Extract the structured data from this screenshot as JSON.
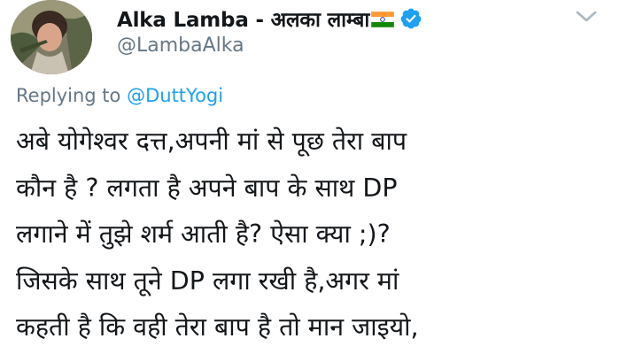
{
  "tweet": {
    "author": {
      "display_name": "Alka Lamba - अलका लाम्बा",
      "handle": "@LambaAlka",
      "verified": true,
      "flag_icon": "india-flag-icon",
      "verified_icon": "verified-badge-icon"
    },
    "menu_icon": "chevron-down-icon",
    "replying_prefix": "Replying to",
    "replying_to": "@DuttYogi",
    "body_lines": [
      "अबे योगेश्वर दत्त,अपनी मां से पूछ तेरा बाप",
      "कौन है ? लगता है अपने बाप के साथ DP",
      "लगाने में तुझे शर्म आती है? ऐसा क्या ;)?",
      "जिसके साथ तूने DP लगा रखी है,अगर मां",
      "कहती है कि वही तेरा बाप है तो मान जाइयो,"
    ]
  },
  "colors": {
    "text_primary": "#14171a",
    "text_secondary": "#657786",
    "link_blue": "#1da1f2",
    "verified_blue": "#1da1f2",
    "flag_saffron": "#ff9933",
    "flag_green": "#138808",
    "flag_chakra": "#000080"
  }
}
